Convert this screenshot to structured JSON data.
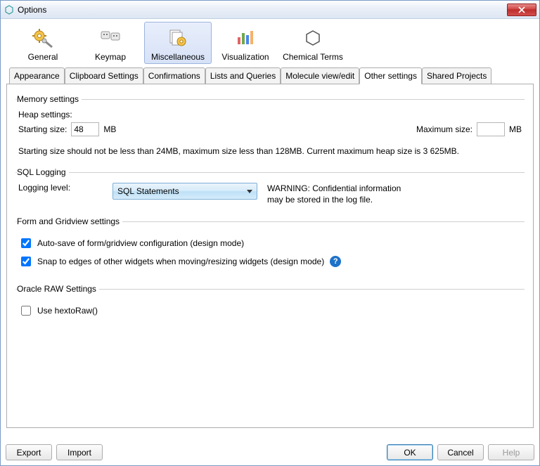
{
  "window": {
    "title": "Options"
  },
  "toolbar": {
    "items": [
      {
        "label": "General"
      },
      {
        "label": "Keymap"
      },
      {
        "label": "Miscellaneous",
        "selected": true
      },
      {
        "label": "Visualization"
      },
      {
        "label": "Chemical Terms"
      }
    ]
  },
  "tabs": {
    "items": [
      {
        "label": "Appearance"
      },
      {
        "label": "Clipboard Settings"
      },
      {
        "label": "Confirmations"
      },
      {
        "label": "Lists and Queries"
      },
      {
        "label": "Molecule view/edit"
      },
      {
        "label": "Other settings",
        "active": true
      },
      {
        "label": "Shared Projects"
      }
    ]
  },
  "memory": {
    "group_title": "Memory settings",
    "heap_label": "Heap settings:",
    "start_label": "Starting size:",
    "start_value": "48",
    "start_unit": "MB",
    "max_label": "Maximum size:",
    "max_value": "",
    "max_unit": "MB",
    "hint": "Starting size should not be less than 24MB, maximum size less than 128MB. Current maximum heap size is 3 625MB."
  },
  "sql": {
    "group_title": "SQL Logging",
    "level_label": "Logging level:",
    "selected": "SQL Statements",
    "warning_line1": "WARNING: Confidential information",
    "warning_line2": "may be stored in the log file."
  },
  "formgrid": {
    "group_title": "Form and Gridview settings",
    "autosave_label": "Auto-save of form/gridview configuration (design mode)",
    "autosave_checked": true,
    "snap_label": "Snap to edges of other widgets when moving/resizing widgets (design mode)",
    "snap_checked": true
  },
  "oracle": {
    "group_title": "Oracle RAW Settings",
    "hextoraw_label": "Use hextoRaw()",
    "hextoraw_checked": false
  },
  "footer": {
    "export": "Export",
    "import": "Import",
    "ok": "OK",
    "cancel": "Cancel",
    "help": "Help"
  }
}
